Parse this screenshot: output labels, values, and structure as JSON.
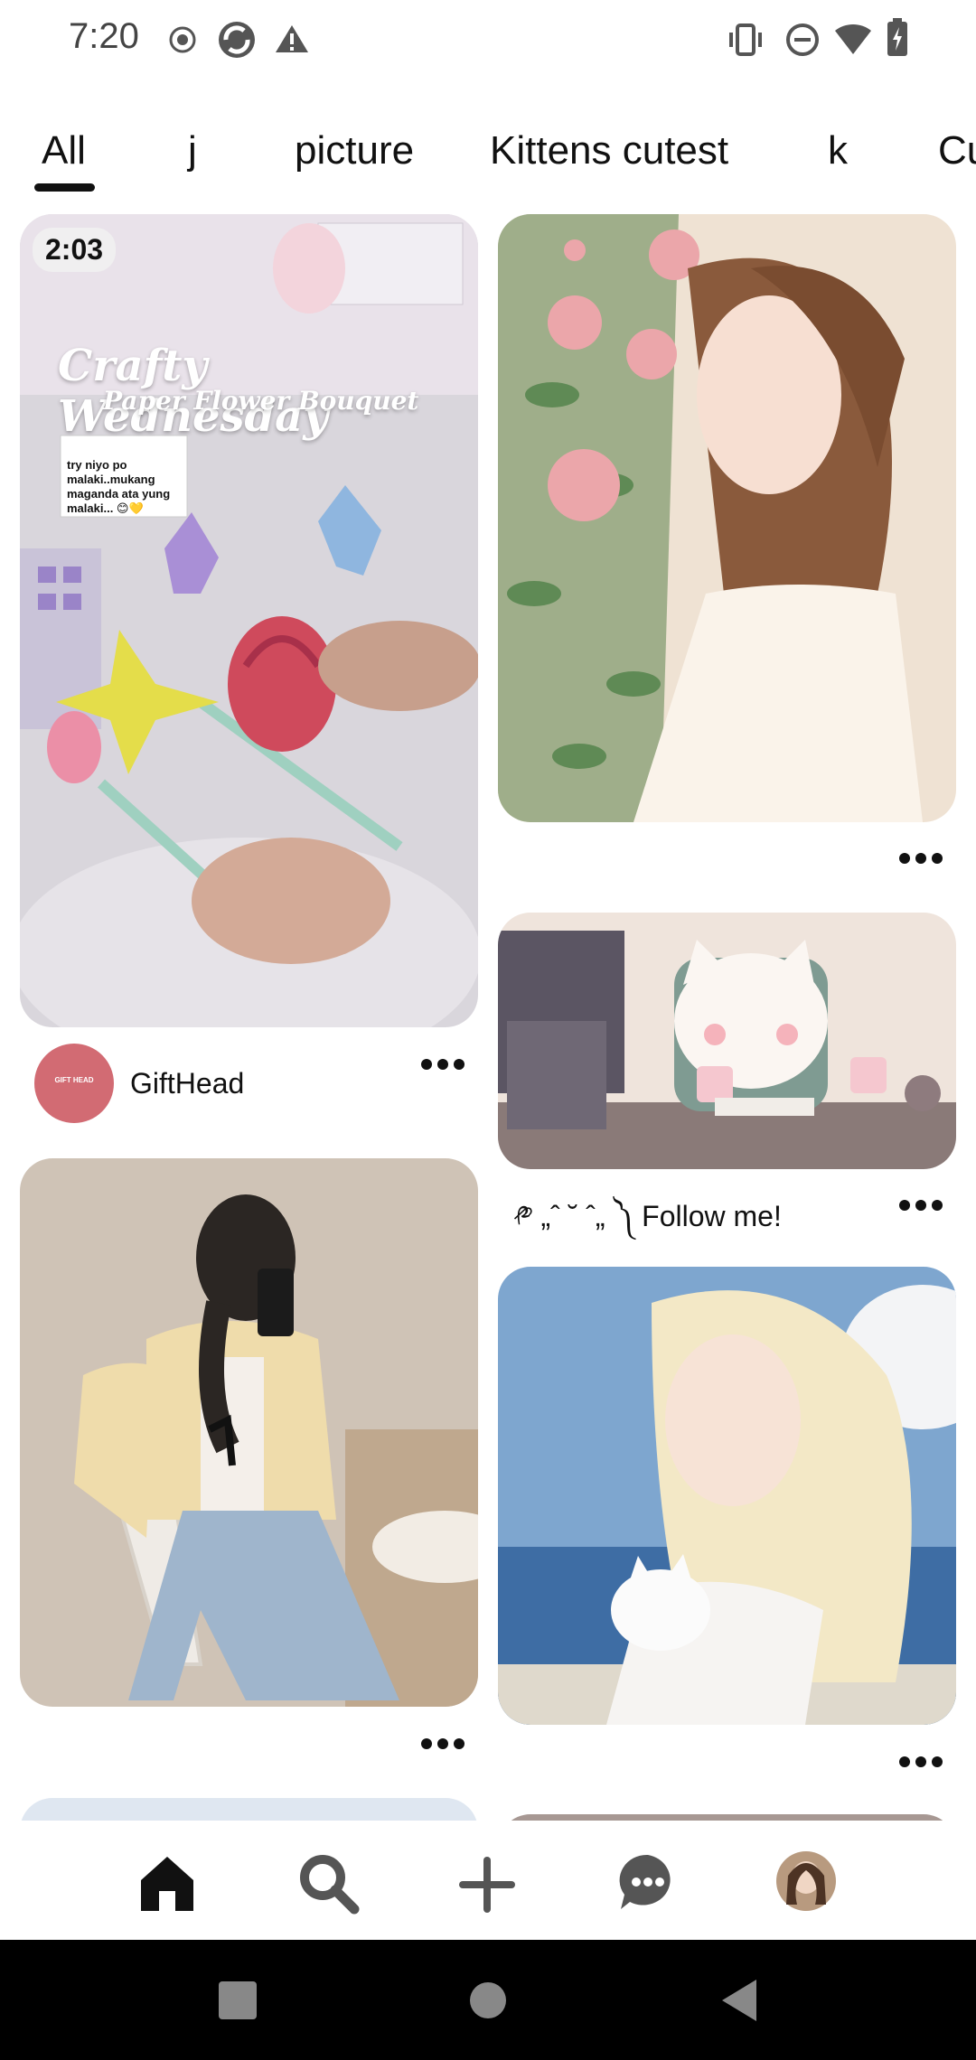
{
  "status_bar": {
    "time": "7:20"
  },
  "tabs": [
    {
      "label": "All",
      "selected": true
    },
    {
      "label": "j"
    },
    {
      "label": "picture"
    },
    {
      "label": "Kittens cutest"
    },
    {
      "label": "k"
    },
    {
      "label": "Cu"
    }
  ],
  "pins": {
    "video_pin": {
      "duration": "2:03",
      "overlay_title": "Crafty Wednesday",
      "overlay_subtitle": "Paper Flower Bouquet",
      "comment_lines": [
        "try niyo po",
        "malaki..mukang",
        "maganda ata yung",
        "malaki... 😊💛"
      ],
      "creator_name": "GiftHead",
      "creator_avatar_text": "GIFT HEAD"
    },
    "cat_pin": {
      "title": "༲ „ˆ ˘ ˆ„ ༽ Follow me!"
    }
  },
  "colors": {
    "accent": "#111111",
    "avatar_bg": "#d26b73"
  },
  "icons": {
    "nav": [
      "home-icon",
      "search-icon",
      "plus-icon",
      "chat-icon",
      "profile-avatar"
    ],
    "system": [
      "recents-square",
      "home-circle",
      "back-triangle"
    ]
  }
}
